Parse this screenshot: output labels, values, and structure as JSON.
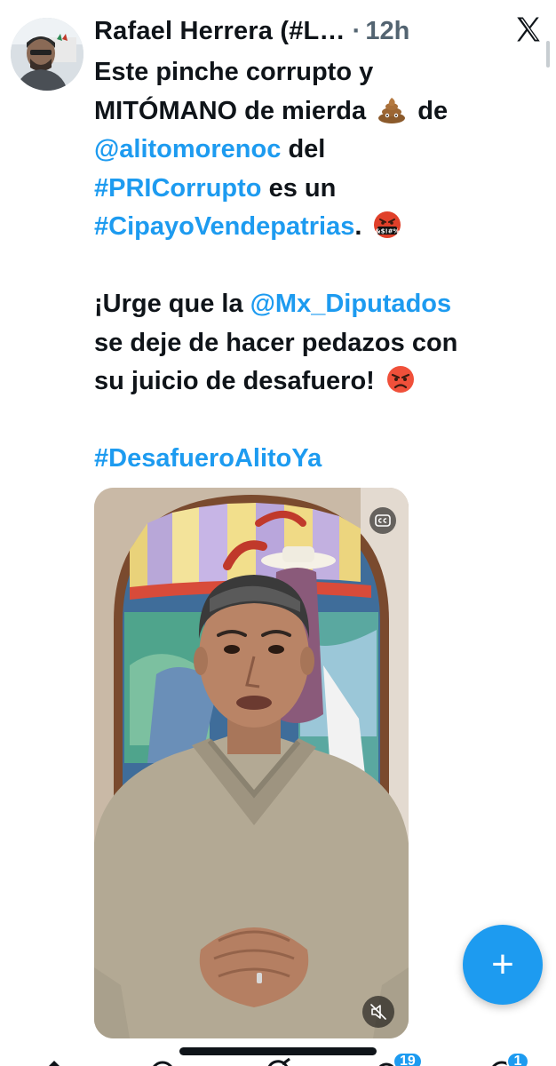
{
  "tweet": {
    "author_name": "Rafael Herrera (#L…",
    "separator": "·",
    "timestamp": "12h",
    "line1_a": "Este pinche corrupto y",
    "line2_a": "MITÓMANO de mierda",
    "line2_b": "de",
    "mention_alito": "@alitomorenoc",
    "line3_b": "del",
    "hashtag_pri": "#PRICorrupto",
    "line4_b": "es un",
    "hashtag_cipayo": "#CipayoVendepatrias",
    "line5_b": ".",
    "para2_a": "¡Urge que la",
    "mention_diputados": "@Mx_Diputados",
    "para2_b": "se deje de hacer pedazos con",
    "para2_c": "su juicio de desafuero!",
    "hashtag_desafuero": "#DesafueroAlitoYa"
  },
  "icons": {
    "brand": "x-logo-icon",
    "more": "more-vertical-icon",
    "poop": "poop-emoji-icon",
    "cursing": "cursing-face-emoji-icon",
    "angry": "angry-face-emoji-icon",
    "captions": "closed-captions-icon",
    "mute": "muted-speaker-icon",
    "compose": "plus-icon"
  },
  "emoji_text": {
    "cursing_symbols": "&$!#%"
  },
  "fab": {
    "label": "+"
  },
  "nav": {
    "notifications_badge": "19",
    "messages_badge": "1"
  },
  "colors": {
    "link": "#1d9bf0",
    "text": "#0f1419",
    "muted": "#536471",
    "fab": "#1d9bf0"
  }
}
